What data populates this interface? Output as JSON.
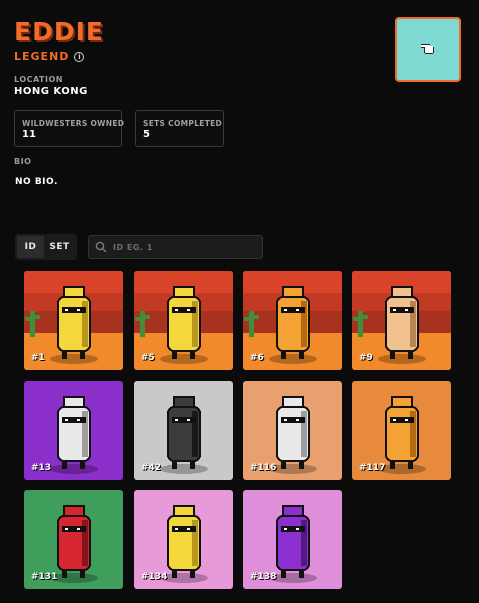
{
  "profile": {
    "name": "EDDIE",
    "rank": "LEGEND",
    "location_label": "LOCATION",
    "location": "HONG KONG",
    "bio_label": "BIO",
    "bio": "NO BIO."
  },
  "stats": {
    "owned_label": "WILDWESTERS OWNED",
    "owned_value": "11",
    "sets_label": "SETS COMPLETED",
    "sets_value": "5"
  },
  "filter": {
    "options": [
      "ID",
      "SET"
    ],
    "selected": "ID",
    "search_placeholder": "ID EG. 1"
  },
  "cards": [
    {
      "label": "#1",
      "bg": "#e9892a",
      "character": "yellow"
    },
    {
      "label": "#5",
      "bg": "#e9892a",
      "character": "yellow"
    },
    {
      "label": "#6",
      "bg": "#e9892a",
      "character": "orange"
    },
    {
      "label": "#9",
      "bg": "#e9892a",
      "character": "peach"
    },
    {
      "label": "#13",
      "bg": "#8a2fc9",
      "character": "white"
    },
    {
      "label": "#42",
      "bg": "#c9c9c9",
      "character": "black"
    },
    {
      "label": "#116",
      "bg": "#e7a06e",
      "character": "white"
    },
    {
      "label": "#117",
      "bg": "#e88a3c",
      "character": "orange"
    },
    {
      "label": "#131",
      "bg": "#3f9e5b",
      "character": "red"
    },
    {
      "label": "#134",
      "bg": "#e79ad8",
      "character": "yellow"
    },
    {
      "label": "#138",
      "bg": "#df8fd9",
      "character": "purple"
    }
  ],
  "colors": {
    "accent": "#f26b2a",
    "background": "#0b0b0b",
    "avatar_bg": "#7ed9d2"
  },
  "icons": {
    "avatar": "pointing-hand-icon",
    "info": "info-icon",
    "search": "search-icon"
  }
}
